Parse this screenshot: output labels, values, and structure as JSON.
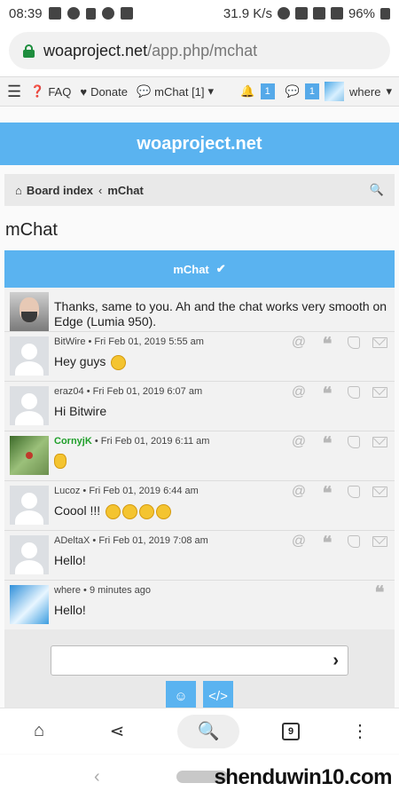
{
  "status": {
    "time": "08:39",
    "speed": "31.9 K/s",
    "battery": "96%"
  },
  "browser": {
    "url_host": "woaproject.net",
    "url_path": "/app.php/mchat"
  },
  "nav": {
    "faq": "FAQ",
    "donate": "Donate",
    "mchat": "mChat [1]",
    "notifications_count": "1",
    "messages_count": "1",
    "user": "where"
  },
  "site": {
    "title": "woaproject.net"
  },
  "breadcrumb": {
    "board_index": "Board index",
    "sep": "‹",
    "current": "mChat"
  },
  "page": {
    "title": "mChat",
    "chat_header": "mChat"
  },
  "messages": [
    {
      "author": "",
      "time": "",
      "text": "Thanks, same to you. Ah and the chat works very smooth on Edge (Lumia 950)."
    },
    {
      "author": "BitWire",
      "time": "• Fri Feb 01, 2019 5:55 am",
      "text": "Hey guys"
    },
    {
      "author": "eraz04",
      "time": "• Fri Feb 01, 2019 6:07 am",
      "text": "Hi Bitwire"
    },
    {
      "author": "CornyjK",
      "time": "• Fri Feb 01, 2019 6:11 am",
      "text": ""
    },
    {
      "author": "Lucoz",
      "time": "• Fri Feb 01, 2019 6:44 am",
      "text": "Coool !!!"
    },
    {
      "author": "ADeltaX",
      "time": "• Fri Feb 01, 2019 7:08 am",
      "text": "Hello!"
    },
    {
      "author": "where",
      "time": "• 9 minutes ago",
      "text": "Hello!"
    }
  ],
  "input": {
    "placeholder": ""
  },
  "bottom": {
    "tab_count": "9"
  },
  "watermark": "shenduwin10.com",
  "colors": {
    "accent": "#5ab3f0",
    "badge": "#55a9e9",
    "highlight_user": "#1f9f2a"
  }
}
